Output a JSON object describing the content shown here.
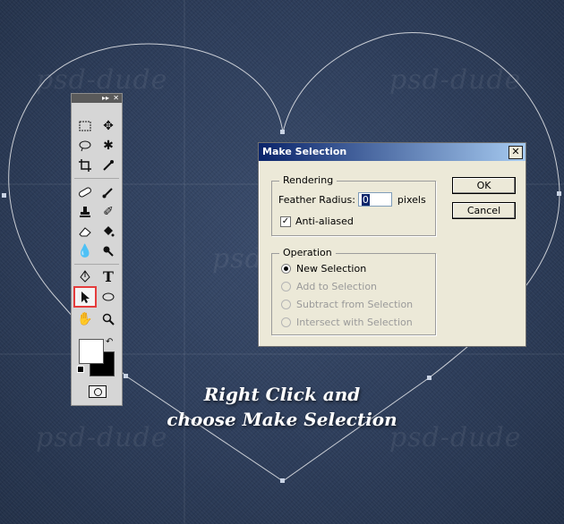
{
  "watermark": "psd-dude",
  "caption": {
    "line1": "Right Click and",
    "line2": "choose Make Selection"
  },
  "toolbox": {
    "title_icons": [
      "collapse-icon",
      "close-icon"
    ],
    "close_glyph": "✕",
    "collapse_glyph": "▸▸",
    "active_tool": "path-selection-tool"
  },
  "dialog": {
    "title": "Make Selection",
    "close_glyph": "✕",
    "rendering": {
      "label": "Rendering",
      "feather_label": "Feather Radius:",
      "feather_value": "0",
      "feather_unit": "pixels",
      "antialias_label": "Anti-aliased",
      "antialias_checked": true
    },
    "operation": {
      "label": "Operation",
      "options": [
        {
          "label": "New Selection",
          "checked": true,
          "enabled": true
        },
        {
          "label": "Add to Selection",
          "checked": false,
          "enabled": false
        },
        {
          "label": "Subtract from Selection",
          "checked": false,
          "enabled": false
        },
        {
          "label": "Intersect with Selection",
          "checked": false,
          "enabled": false
        }
      ]
    },
    "ok_label": "OK",
    "cancel_label": "Cancel"
  }
}
